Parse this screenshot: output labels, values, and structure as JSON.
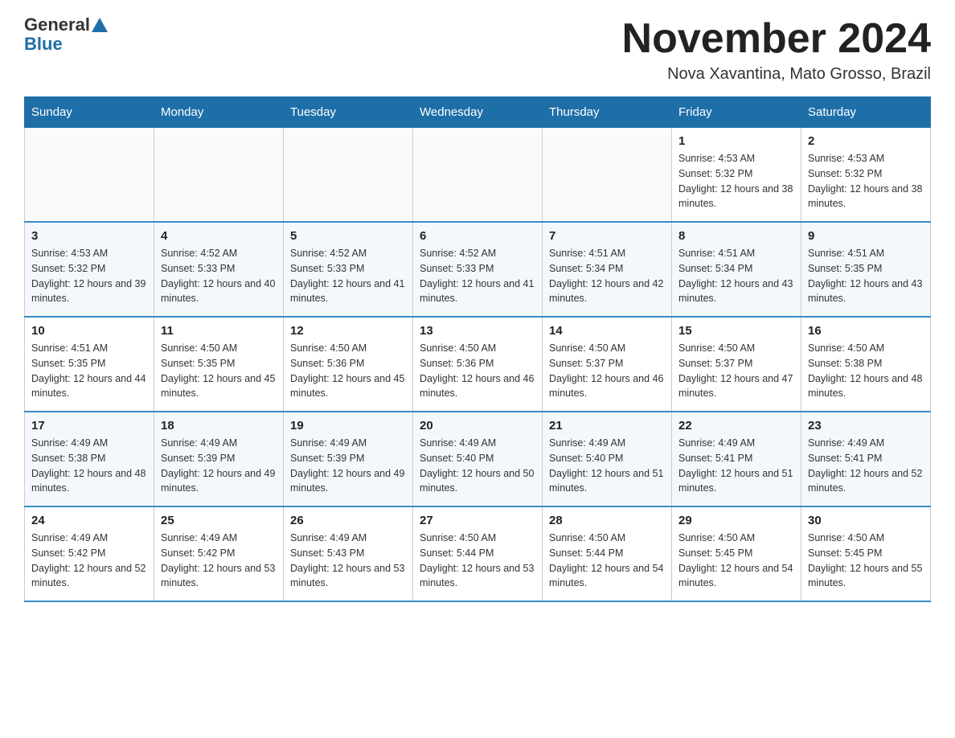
{
  "logo": {
    "general": "General",
    "blue": "Blue"
  },
  "header": {
    "title": "November 2024",
    "location": "Nova Xavantina, Mato Grosso, Brazil"
  },
  "weekdays": [
    "Sunday",
    "Monday",
    "Tuesday",
    "Wednesday",
    "Thursday",
    "Friday",
    "Saturday"
  ],
  "weeks": [
    [
      {
        "day": "",
        "info": ""
      },
      {
        "day": "",
        "info": ""
      },
      {
        "day": "",
        "info": ""
      },
      {
        "day": "",
        "info": ""
      },
      {
        "day": "",
        "info": ""
      },
      {
        "day": "1",
        "info": "Sunrise: 4:53 AM\nSunset: 5:32 PM\nDaylight: 12 hours and 38 minutes."
      },
      {
        "day": "2",
        "info": "Sunrise: 4:53 AM\nSunset: 5:32 PM\nDaylight: 12 hours and 38 minutes."
      }
    ],
    [
      {
        "day": "3",
        "info": "Sunrise: 4:53 AM\nSunset: 5:32 PM\nDaylight: 12 hours and 39 minutes."
      },
      {
        "day": "4",
        "info": "Sunrise: 4:52 AM\nSunset: 5:33 PM\nDaylight: 12 hours and 40 minutes."
      },
      {
        "day": "5",
        "info": "Sunrise: 4:52 AM\nSunset: 5:33 PM\nDaylight: 12 hours and 41 minutes."
      },
      {
        "day": "6",
        "info": "Sunrise: 4:52 AM\nSunset: 5:33 PM\nDaylight: 12 hours and 41 minutes."
      },
      {
        "day": "7",
        "info": "Sunrise: 4:51 AM\nSunset: 5:34 PM\nDaylight: 12 hours and 42 minutes."
      },
      {
        "day": "8",
        "info": "Sunrise: 4:51 AM\nSunset: 5:34 PM\nDaylight: 12 hours and 43 minutes."
      },
      {
        "day": "9",
        "info": "Sunrise: 4:51 AM\nSunset: 5:35 PM\nDaylight: 12 hours and 43 minutes."
      }
    ],
    [
      {
        "day": "10",
        "info": "Sunrise: 4:51 AM\nSunset: 5:35 PM\nDaylight: 12 hours and 44 minutes."
      },
      {
        "day": "11",
        "info": "Sunrise: 4:50 AM\nSunset: 5:35 PM\nDaylight: 12 hours and 45 minutes."
      },
      {
        "day": "12",
        "info": "Sunrise: 4:50 AM\nSunset: 5:36 PM\nDaylight: 12 hours and 45 minutes."
      },
      {
        "day": "13",
        "info": "Sunrise: 4:50 AM\nSunset: 5:36 PM\nDaylight: 12 hours and 46 minutes."
      },
      {
        "day": "14",
        "info": "Sunrise: 4:50 AM\nSunset: 5:37 PM\nDaylight: 12 hours and 46 minutes."
      },
      {
        "day": "15",
        "info": "Sunrise: 4:50 AM\nSunset: 5:37 PM\nDaylight: 12 hours and 47 minutes."
      },
      {
        "day": "16",
        "info": "Sunrise: 4:50 AM\nSunset: 5:38 PM\nDaylight: 12 hours and 48 minutes."
      }
    ],
    [
      {
        "day": "17",
        "info": "Sunrise: 4:49 AM\nSunset: 5:38 PM\nDaylight: 12 hours and 48 minutes."
      },
      {
        "day": "18",
        "info": "Sunrise: 4:49 AM\nSunset: 5:39 PM\nDaylight: 12 hours and 49 minutes."
      },
      {
        "day": "19",
        "info": "Sunrise: 4:49 AM\nSunset: 5:39 PM\nDaylight: 12 hours and 49 minutes."
      },
      {
        "day": "20",
        "info": "Sunrise: 4:49 AM\nSunset: 5:40 PM\nDaylight: 12 hours and 50 minutes."
      },
      {
        "day": "21",
        "info": "Sunrise: 4:49 AM\nSunset: 5:40 PM\nDaylight: 12 hours and 51 minutes."
      },
      {
        "day": "22",
        "info": "Sunrise: 4:49 AM\nSunset: 5:41 PM\nDaylight: 12 hours and 51 minutes."
      },
      {
        "day": "23",
        "info": "Sunrise: 4:49 AM\nSunset: 5:41 PM\nDaylight: 12 hours and 52 minutes."
      }
    ],
    [
      {
        "day": "24",
        "info": "Sunrise: 4:49 AM\nSunset: 5:42 PM\nDaylight: 12 hours and 52 minutes."
      },
      {
        "day": "25",
        "info": "Sunrise: 4:49 AM\nSunset: 5:42 PM\nDaylight: 12 hours and 53 minutes."
      },
      {
        "day": "26",
        "info": "Sunrise: 4:49 AM\nSunset: 5:43 PM\nDaylight: 12 hours and 53 minutes."
      },
      {
        "day": "27",
        "info": "Sunrise: 4:50 AM\nSunset: 5:44 PM\nDaylight: 12 hours and 53 minutes."
      },
      {
        "day": "28",
        "info": "Sunrise: 4:50 AM\nSunset: 5:44 PM\nDaylight: 12 hours and 54 minutes."
      },
      {
        "day": "29",
        "info": "Sunrise: 4:50 AM\nSunset: 5:45 PM\nDaylight: 12 hours and 54 minutes."
      },
      {
        "day": "30",
        "info": "Sunrise: 4:50 AM\nSunset: 5:45 PM\nDaylight: 12 hours and 55 minutes."
      }
    ]
  ]
}
